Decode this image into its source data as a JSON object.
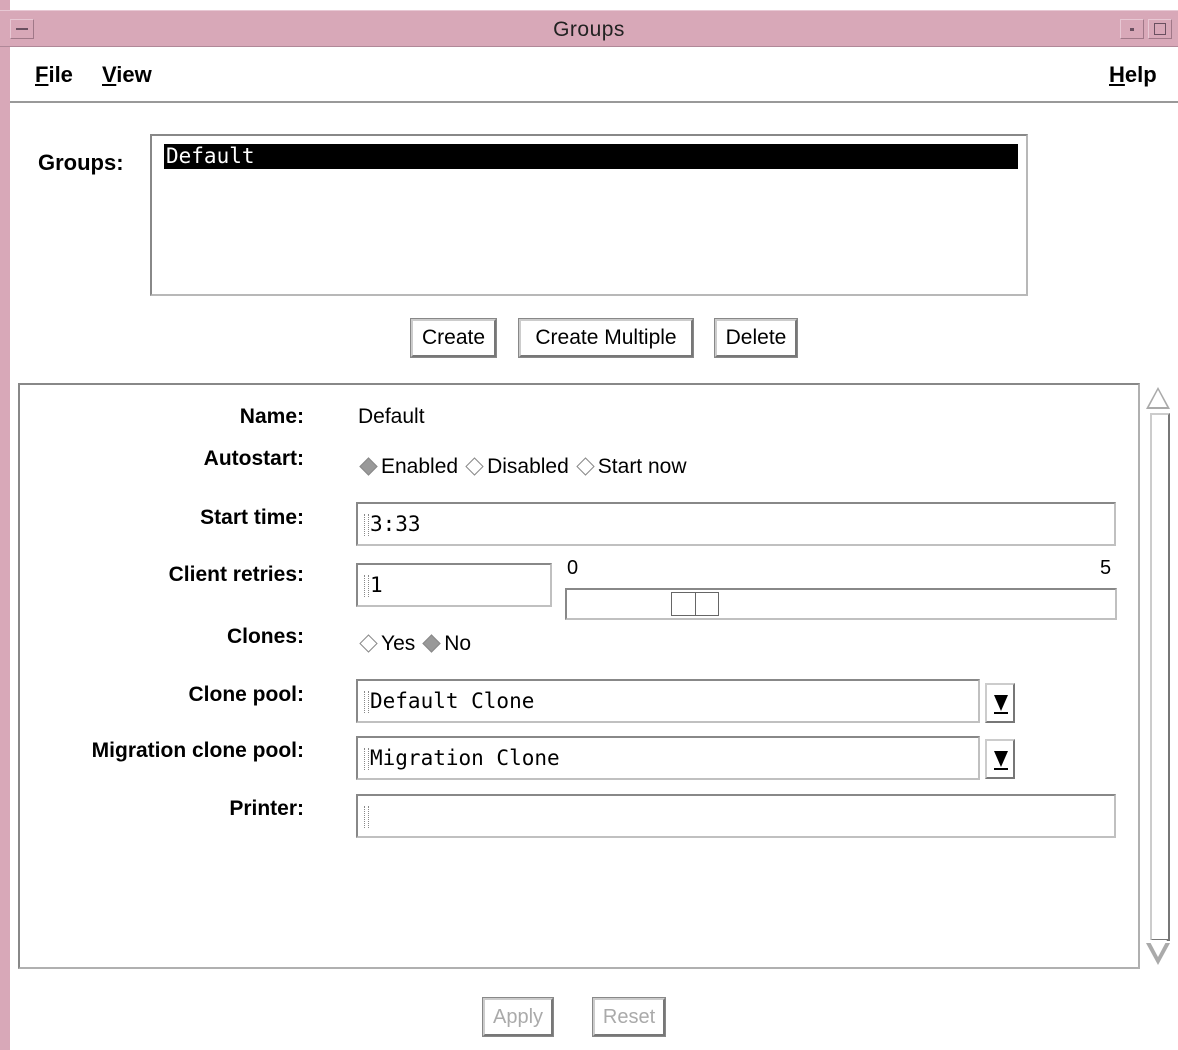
{
  "window": {
    "title": "Groups",
    "frame_color": "#d8a8b8"
  },
  "menubar": {
    "file": {
      "mnemonic": "F",
      "rest": "ile"
    },
    "view": {
      "mnemonic": "V",
      "rest": "iew"
    },
    "help": {
      "mnemonic": "H",
      "rest": "elp"
    }
  },
  "groups": {
    "label": "Groups:",
    "items": [
      "Default"
    ],
    "selected": "Default"
  },
  "group_buttons": {
    "create": "Create",
    "create_multiple": "Create Multiple",
    "delete": "Delete"
  },
  "details": {
    "name": {
      "label": "Name:",
      "value": "Default"
    },
    "autostart": {
      "label": "Autostart:",
      "options": [
        "Enabled",
        "Disabled",
        "Start now"
      ],
      "selected": "Enabled"
    },
    "start_time": {
      "label": "Start time:",
      "value": "3:33"
    },
    "client_retries": {
      "label": "Client retries:",
      "value": "1",
      "slider_min": "0",
      "slider_max": "5",
      "slider_value": 1
    },
    "clones": {
      "label": "Clones:",
      "options": [
        "Yes",
        "No"
      ],
      "selected": "No"
    },
    "clone_pool": {
      "label": "Clone pool:",
      "value": "Default Clone"
    },
    "migration_clone_pool": {
      "label": "Migration clone pool:",
      "value": "Migration Clone"
    },
    "printer": {
      "label": "Printer:",
      "value": ""
    }
  },
  "footer": {
    "apply": "Apply",
    "reset": "Reset",
    "apply_enabled": false,
    "reset_enabled": false
  }
}
